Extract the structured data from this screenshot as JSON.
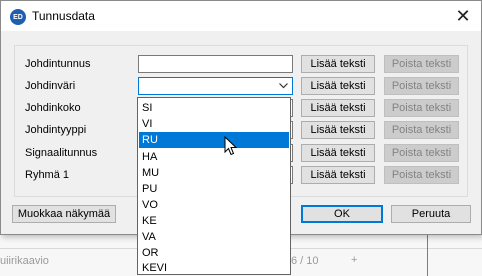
{
  "background": {
    "left_text": "uiirikaavio",
    "page_indicator": "6 / 10",
    "plus": "+"
  },
  "dialog": {
    "title": "Tunnusdata",
    "app_icon_text": "ED",
    "close_symbol": "✕",
    "rows": [
      {
        "label": "Johdintunnus",
        "value": "",
        "add": "Lisää teksti",
        "remove": "Poista teksti"
      },
      {
        "label": "Johdinväri",
        "value": "",
        "add": "Lisää teksti",
        "remove": "Poista teksti"
      },
      {
        "label": "Johdinkoko",
        "value": "",
        "add": "Lisää teksti",
        "remove": "Poista teksti"
      },
      {
        "label": "Johdintyyppi",
        "value": "",
        "add": "Lisää teksti",
        "remove": "Poista teksti"
      },
      {
        "label": "Signaalitunnus",
        "value": "",
        "add": "Lisää teksti",
        "remove": "Poista teksti"
      },
      {
        "label": "Ryhmä 1",
        "value": "",
        "add": "Lisää teksti",
        "remove": "Poista teksti"
      }
    ],
    "buttons": {
      "edit_view": "Muokkaa näkymää",
      "ok": "OK",
      "cancel": "Peruuta"
    }
  },
  "dropdown": {
    "options": [
      "SI",
      "VI",
      "RU",
      "HA",
      "MU",
      "PU",
      "VO",
      "KE",
      "VA",
      "OR",
      "KEVI"
    ],
    "highlighted": "RU"
  },
  "colors": {
    "accent": "#0078d7",
    "disabled_text": "#838383"
  }
}
